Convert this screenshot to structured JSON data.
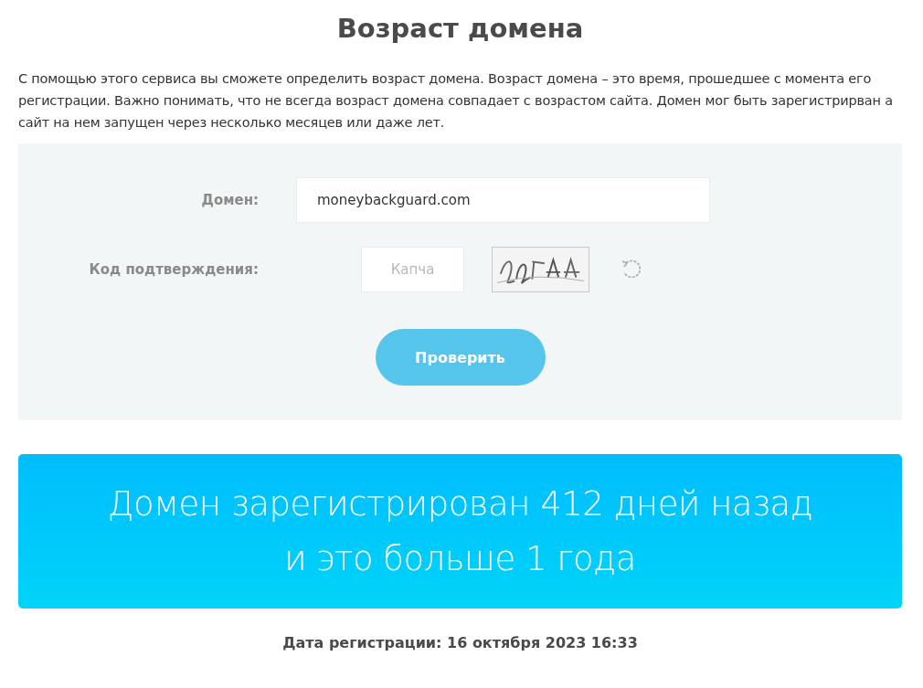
{
  "title": "Возраст домена",
  "description": "С помощью этого сервиса вы сможете определить возраст домена. Возраст домена – это время, прошедшее с момента его регистрации. Важно понимать, что не всегда возраст домена совпадает с возрастом сайта. Домен мог быть зарегистрирван а сайт на нем запущен через несколько месяцев или даже лет.",
  "form": {
    "domain": {
      "label": "Домен:",
      "value": "moneybackguard.com"
    },
    "captcha": {
      "label": "Код подтверждения:",
      "placeholder": "Капча"
    },
    "submit": "Проверить"
  },
  "result": {
    "lines": [
      "Домен зарегистрирован 412 дней назад",
      "и это больше 1 года"
    ]
  },
  "registration_date": "Дата регистрации: 16 октября 2023 16:33"
}
